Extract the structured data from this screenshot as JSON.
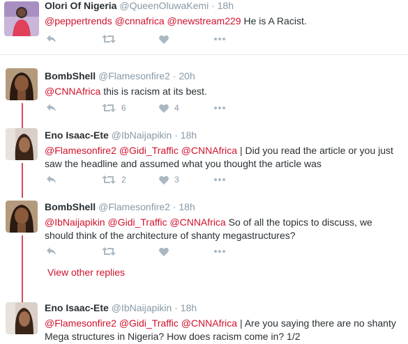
{
  "colors": {
    "link": "#d0112b",
    "thread_line": "#d5485a",
    "meta": "#8899a6",
    "text": "#292f33"
  },
  "tweets": [
    {
      "fullname": "Olori Of Nigeria",
      "username": "@QueenOluwaKemi",
      "separator": "·",
      "time": "18h",
      "text": [
        {
          "t": "@peppertrends",
          "m": true
        },
        {
          "t": " ",
          "m": false
        },
        {
          "t": "@cnnafrica",
          "m": true
        },
        {
          "t": " ",
          "m": false
        },
        {
          "t": "@newstream229",
          "m": true
        },
        {
          "t": " He is A Racist.",
          "m": false
        }
      ],
      "retweets": "",
      "likes": ""
    },
    {
      "fullname": "BombShell",
      "username": "@Flamesonfire2",
      "separator": "·",
      "time": "20h",
      "text": [
        {
          "t": "@CNNAfrica",
          "m": true
        },
        {
          "t": " this is racism at its best.",
          "m": false
        }
      ],
      "retweets": "6",
      "likes": "4"
    },
    {
      "fullname": "Eno Isaac-Ete",
      "username": "@IbNaijapikin",
      "separator": "·",
      "time": "18h",
      "text": [
        {
          "t": "@Flamesonfire2",
          "m": true
        },
        {
          "t": " ",
          "m": false
        },
        {
          "t": "@Gidi_Traffic",
          "m": true
        },
        {
          "t": " ",
          "m": false
        },
        {
          "t": "@CNNAfrica",
          "m": true
        },
        {
          "t": " | Did you read the article or you just saw the headline and assumed what you thought the article was",
          "m": false
        }
      ],
      "retweets": "2",
      "likes": "3"
    },
    {
      "fullname": "BombShell",
      "username": "@Flamesonfire2",
      "separator": "·",
      "time": "18h",
      "text": [
        {
          "t": "@IbNaijapikin",
          "m": true
        },
        {
          "t": " ",
          "m": false
        },
        {
          "t": "@Gidi_Traffic",
          "m": true
        },
        {
          "t": " ",
          "m": false
        },
        {
          "t": "@CNNAfrica",
          "m": true
        },
        {
          "t": " So of all the topics to discuss, we should think of the architecture of shanty megastructures?",
          "m": false
        }
      ],
      "retweets": "",
      "likes": ""
    },
    {
      "fullname": "Eno Isaac-Ete",
      "username": "@IbNaijapikin",
      "separator": "·",
      "time": "18h",
      "text": [
        {
          "t": "@Flamesonfire2",
          "m": true
        },
        {
          "t": " ",
          "m": false
        },
        {
          "t": "@Gidi_Traffic",
          "m": true
        },
        {
          "t": " ",
          "m": false
        },
        {
          "t": "@CNNAfrica",
          "m": true
        },
        {
          "t": " | Are you saying there are no shanty Mega structures in Nigeria? How does racism come in? 1/2",
          "m": false
        }
      ],
      "retweets": "",
      "likes": ""
    }
  ],
  "view_other_replies": "View other replies",
  "icons": [
    "reply-icon",
    "retweet-icon",
    "like-icon",
    "more-icon"
  ]
}
